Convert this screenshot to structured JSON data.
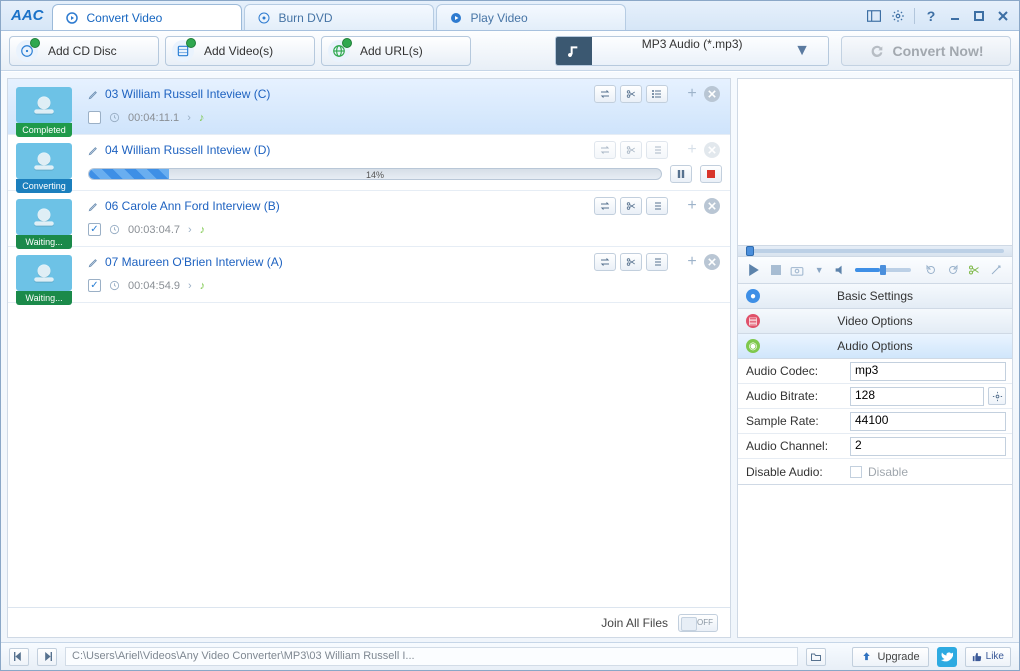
{
  "logo": "AAC",
  "tabs": [
    {
      "label": "Convert Video"
    },
    {
      "label": "Burn DVD"
    },
    {
      "label": "Play Video"
    }
  ],
  "toolbar": {
    "addCd": "Add CD Disc",
    "addVideos": "Add Video(s)",
    "addUrls": "Add URL(s)",
    "format": "MP3 Audio (*.mp3)",
    "convert": "Convert Now!"
  },
  "items": [
    {
      "title": "03 William Russell Inteview (C)",
      "status": "Completed",
      "duration": "00:04:11.1",
      "checked": false,
      "progress": null
    },
    {
      "title": "04 William Russell Inteview (D)",
      "status": "Converting",
      "duration": "",
      "checked": false,
      "progress": 14,
      "pct": "14%"
    },
    {
      "title": "06 Carole Ann Ford Interview (B)",
      "status": "Waiting...",
      "duration": "00:03:04.7",
      "checked": true,
      "progress": null
    },
    {
      "title": "07 Maureen O'Brien Interview (A)",
      "status": "Waiting...",
      "duration": "00:04:54.9",
      "checked": true,
      "progress": null
    }
  ],
  "listfooter": {
    "join": "Join All Files",
    "toggle": "OFF"
  },
  "sections": {
    "basic": "Basic Settings",
    "video": "Video Options",
    "audio": "Audio Options"
  },
  "audio": {
    "codecLabel": "Audio Codec:",
    "codec": "mp3",
    "bitrateLabel": "Audio Bitrate:",
    "bitrate": "128",
    "sampleLabel": "Sample Rate:",
    "sample": "44100",
    "channelLabel": "Audio Channel:",
    "channel": "2",
    "disableLabel": "Disable Audio:",
    "disableText": "Disable"
  },
  "status": {
    "path": "C:\\Users\\Ariel\\Videos\\Any Video Converter\\MP3\\03 William Russell I...",
    "upgrade": "Upgrade",
    "like": "Like"
  }
}
